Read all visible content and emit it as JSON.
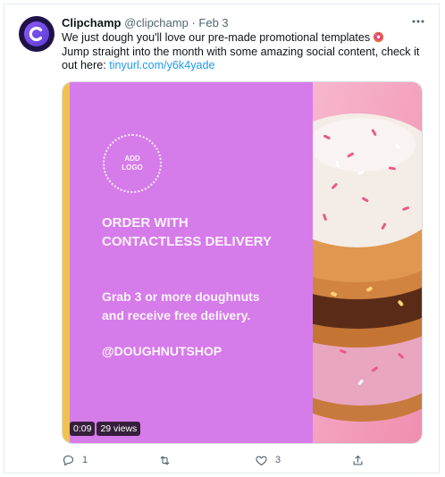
{
  "tweet": {
    "author_name": "Clipchamp",
    "handle": "@clipchamp",
    "separator": "·",
    "date": "Feb 3",
    "text_line1": "We just dough you'll love our pre-made promotional templates",
    "text_line2": "Jump straight into the month with some amazing social content, check it out here:",
    "link": "tinyurl.com/y6k4yade",
    "more_icon": "ellipsis-icon",
    "avatar_icon": "clipchamp-logo-icon"
  },
  "media": {
    "logo_placeholder_line1": "ADD",
    "logo_placeholder_line2": "LOGO",
    "heading_line1": "ORDER WITH",
    "heading_line2": "CONTACTLESS DELIVERY",
    "body_line1": "Grab 3 or more doughnuts",
    "body_line2": "and receive free delivery.",
    "shop_handle": "@DOUGHNUTSHOP",
    "duration": "0:09",
    "views": "29 views",
    "colors": {
      "panel": "#d67bea",
      "accent_strip": "#f2c14a",
      "photo_bg": "#f6a7c3"
    }
  },
  "actions": {
    "reply_count": "1",
    "retweet_count": "",
    "like_count": "3",
    "share_count": ""
  }
}
